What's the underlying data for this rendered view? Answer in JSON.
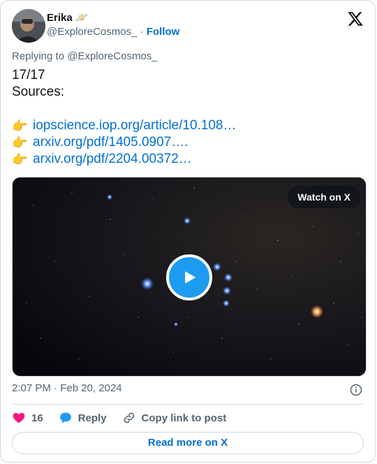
{
  "author": {
    "name": "Erika 🪐",
    "handle": "@ExploreCosmos_",
    "separator": "·",
    "follow_label": "Follow"
  },
  "replying_to": "Replying to @ExploreCosmos_",
  "tweet": {
    "text": "17/17\nSources:",
    "links": [
      {
        "emoji": "👉",
        "text": "iopscience.iop.org/article/10.108…"
      },
      {
        "emoji": "👉",
        "text": "arxiv.org/pdf/1405.0907…."
      },
      {
        "emoji": "👉",
        "text": "arxiv.org/pdf/2204.00372…"
      }
    ]
  },
  "media": {
    "watch_label": "Watch on X",
    "play_icon": "play-icon"
  },
  "timestamp": "2:07 PM · Feb 20, 2024",
  "actions": {
    "like_count": "16",
    "reply_label": "Reply",
    "copy_label": "Copy link to post"
  },
  "read_more_label": "Read more on X",
  "colors": {
    "accent": "#1d9bf0",
    "link": "#006fd6",
    "like": "#f91880",
    "muted": "#536471"
  }
}
